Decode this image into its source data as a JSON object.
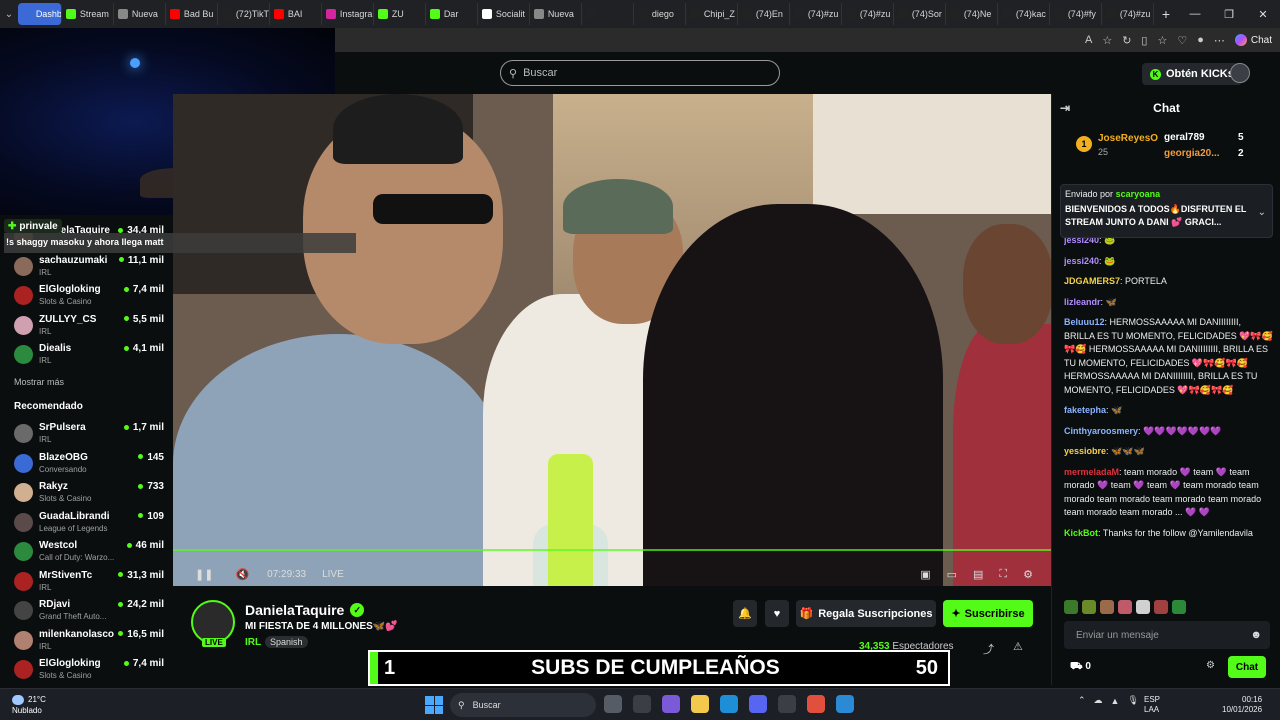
{
  "browser": {
    "tabs": [
      {
        "label": "Dashbo",
        "color": "#3b6ad6",
        "active": true
      },
      {
        "label": "Stream",
        "color": "#53fc18"
      },
      {
        "label": "Nueva",
        "color": "#888888"
      },
      {
        "label": "Bad Bu",
        "color": "#ff0000"
      },
      {
        "label": "(72)TikT",
        "color": "#222222"
      },
      {
        "label": "BAI",
        "color": "#ff0000"
      },
      {
        "label": "Instagra",
        "color": "#d6249f"
      },
      {
        "label": "ZU",
        "color": "#53fc18"
      },
      {
        "label": "Dar",
        "color": "#53fc18"
      },
      {
        "label": "Socialit",
        "color": "#ffffff"
      },
      {
        "label": "Nueva",
        "color": "#888888"
      },
      {
        "label": "",
        "color": "#222222"
      },
      {
        "label": "diego",
        "color": "#222222"
      },
      {
        "label": "Chipi_Z",
        "color": "#222222"
      },
      {
        "label": "(74)En",
        "color": "#222222"
      },
      {
        "label": "(74)#zu",
        "color": "#222222"
      },
      {
        "label": "(74)#zu",
        "color": "#222222"
      },
      {
        "label": "(74)Sor",
        "color": "#222222"
      },
      {
        "label": "(74)Ne",
        "color": "#222222"
      },
      {
        "label": "(74)kac",
        "color": "#222222"
      },
      {
        "label": "(74)#fy",
        "color": "#222222"
      },
      {
        "label": "(74)#zu",
        "color": "#222222"
      }
    ],
    "copilot_label": "Chat"
  },
  "header": {
    "search_placeholder": "Buscar",
    "kicks_label": "Obtén KICKs"
  },
  "overlay": {
    "tag": "prinvale",
    "message": "!s shaggy masoku y ahora llega matt"
  },
  "sidebar": {
    "channels": [
      {
        "name": "DanielaTaquire",
        "category": "",
        "viewers": "34,4 mil",
        "color": "#7a5a3a"
      },
      {
        "name": "sachauzumaki",
        "category": "IRL",
        "viewers": "11,1 mil",
        "color": "#8a6a5a"
      },
      {
        "name": "ElGlogloking",
        "category": "Slots & Casino",
        "viewers": "7,4 mil",
        "color": "#aa2222"
      },
      {
        "name": "ZULLYY_CS",
        "category": "IRL",
        "viewers": "5,5 mil",
        "color": "#d0a0b0"
      },
      {
        "name": "Diealis",
        "category": "IRL",
        "viewers": "4,1 mil",
        "color": "#2b8a3e"
      }
    ],
    "show_more": "Mostrar más",
    "recommended_heading": "Recomendado",
    "recommended": [
      {
        "name": "SrPulsera",
        "category": "IRL",
        "viewers": "1,7 mil",
        "color": "#6a6a6a"
      },
      {
        "name": "BlazeOBG",
        "category": "Conversando",
        "viewers": "145",
        "color": "#3a6ad6"
      },
      {
        "name": "Rakyz",
        "category": "Slots & Casino",
        "viewers": "733",
        "color": "#d0b090"
      },
      {
        "name": "GuadaLibrandi",
        "category": "League of Legends",
        "viewers": "109",
        "color": "#5a4a4a"
      },
      {
        "name": "Westcol",
        "category": "Call of Duty: Warzo...",
        "viewers": "46 mil",
        "color": "#2b8a3e"
      },
      {
        "name": "MrStivenTc",
        "category": "IRL",
        "viewers": "31,3 mil",
        "color": "#aa2222"
      },
      {
        "name": "RDjavi",
        "category": "Grand Theft Auto...",
        "viewers": "24,2 mil",
        "color": "#444444"
      },
      {
        "name": "milenkanolasco",
        "category": "IRL",
        "viewers": "16,5 mil",
        "color": "#b08070"
      },
      {
        "name": "ElGlogloking",
        "category": "Slots & Casino",
        "viewers": "7,4 mil",
        "color": "#aa2222"
      }
    ]
  },
  "player": {
    "time": "07:29:33",
    "live": "LIVE"
  },
  "stream": {
    "name": "DanielaTaquire",
    "live_badge": "LIVE",
    "title": "MI FIESTA DE 4 MILLONES🦋💕",
    "category": "IRL",
    "tag": "Spanish",
    "gift_label": "Regala Suscripciones",
    "subscribe_label": "Suscribirse",
    "viewers_count": "34,353",
    "viewers_label": "Espectadores"
  },
  "subs_goal": {
    "current": "1",
    "title": "SUBS DE CUMPLEAÑOS",
    "goal": "50"
  },
  "chat": {
    "title": "Chat",
    "leaderboard": {
      "first_name": "JoseReyesO",
      "first_count": "25",
      "second_name": "geral789",
      "second_count": "5",
      "third_name": "georgia20...",
      "third_count": "2"
    },
    "pinned": {
      "by_label": "Enviado por",
      "by_user": "scaryoana",
      "message": "BIENVENIDOS A TODOS🔥DISFRUTEN EL STREAM JUNTO A DANI 💕 GRACI..."
    },
    "messages": [
      {
        "user": "jessi240",
        "color": "#b18cff",
        "text": "🐸"
      },
      {
        "user": "jessi240",
        "color": "#b18cff",
        "text": "🐸"
      },
      {
        "user": "JDGAMERS7",
        "color": "#f2d24a",
        "text": "PORTELA"
      },
      {
        "user": "lizleandr",
        "color": "#b18cff",
        "text": "🦋"
      },
      {
        "user": "Beluuu12",
        "color": "#8ab4ff",
        "text": "HERMOSSAAAAA MI DANIIIIIIII, BRILLA ES TU MOMENTO, FELICIDADES 💖🎀🥰🎀🥰 HERMOSSAAAAA MI DANIIIIIIII, BRILLA ES TU MOMENTO, FELICIDADES 💖🎀🥰🎀🥰 HERMOSSAAAAA MI DANIIIIIIII, BRILLA ES TU MOMENTO, FELICIDADES 💖🎀🥰🎀🥰"
      },
      {
        "user": "faketepha",
        "color": "#8ab4ff",
        "text": "🦋"
      },
      {
        "user": "Cinthyaroosmery",
        "color": "#8ab4ff",
        "text": "💜💜💜💜💜💜💜"
      },
      {
        "user": "yessiobre",
        "color": "#f2d24a",
        "text": "🦋🦋🦋"
      },
      {
        "user": "mermeladaM",
        "color": "#e0303c",
        "text": "team morado 💜 team 💜 team morado 💜 team 💜 team 💜 team morado team morado team morado team morado team morado team morado team morado ... 💜 💜"
      },
      {
        "user": "KickBot",
        "color": "#53fc18",
        "text": "Thanks for the follow @Yamilendavila"
      }
    ],
    "input_placeholder": "Enviar un mensaje",
    "points": "0",
    "send_label": "Chat"
  },
  "taskbar": {
    "temp": "21°C",
    "weather": "Nublado",
    "search": "Buscar",
    "lang_top": "ESP",
    "lang_bottom": "LAA",
    "time": "00:16",
    "date": "10/01/2026"
  }
}
